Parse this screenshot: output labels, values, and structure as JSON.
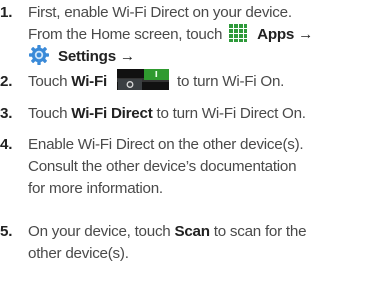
{
  "steps": [
    {
      "num": "1.",
      "line1": "First, enable Wi-Fi Direct on your device.",
      "line2_pre": "From the Home screen, touch",
      "apps_label": "Apps",
      "arrow1": "→",
      "settings_label": "Settings",
      "arrow2": "→"
    },
    {
      "num": "2.",
      "pre": "Touch",
      "wifi_label": "Wi-Fi",
      "post": "to turn Wi-Fi On."
    },
    {
      "num": "3.",
      "pre": "Touch",
      "direct_label": "Wi-Fi Direct",
      "post": "to turn Wi-Fi Direct On."
    },
    {
      "num": "4.",
      "line1": "Enable Wi-Fi Direct on the other device(s).",
      "line2": "Consult the other device’s documentation",
      "line3": "for more information."
    },
    {
      "num": "5.",
      "pre": "On your device, touch",
      "scan_label": "Scan",
      "post": "to scan for the",
      "line2": "other device(s)."
    }
  ],
  "icons": {
    "apps": "apps-grid-icon",
    "settings": "settings-gear-icon",
    "wifi_toggle": "wifi-toggle-icon"
  },
  "colors": {
    "apps_icon": "#2e9a3a",
    "settings_icon": "#3a8ad8",
    "toggle_on": "#2f9a2f",
    "toggle_bar": "#111111",
    "text": "#4a4a4a",
    "emphasis": "#222222"
  }
}
